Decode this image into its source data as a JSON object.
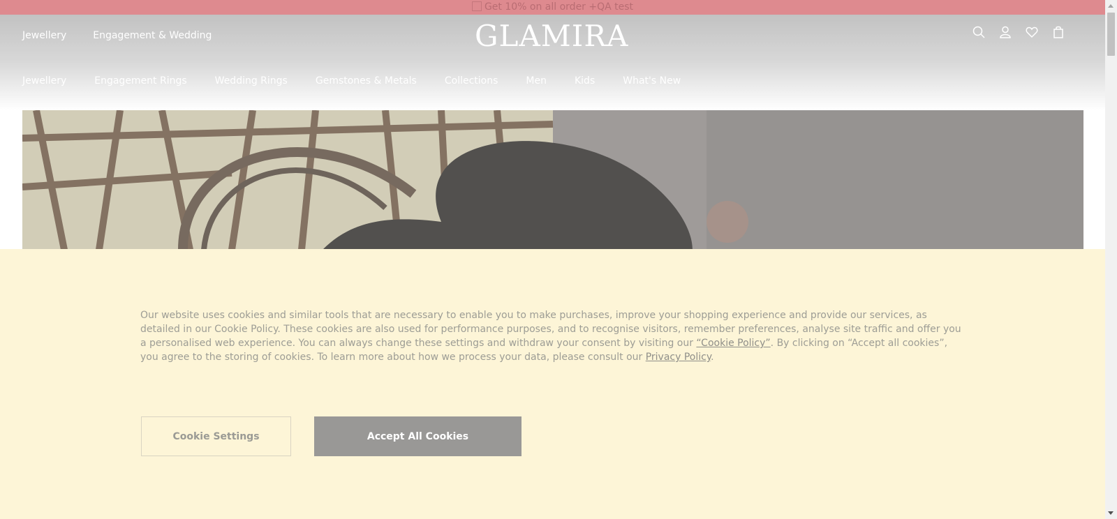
{
  "promo": {
    "text": "Get 10% on all order +QA test"
  },
  "header": {
    "top_nav": [
      "Jewellery",
      "Engagement & Wedding"
    ],
    "logo": "GLAMIRA",
    "main_nav": [
      "Jewellery",
      "Engagement Rings",
      "Wedding Rings",
      "Gemstones & Metals",
      "Collections",
      "Men",
      "Kids",
      "What's New"
    ],
    "icons": [
      "search-icon",
      "account-icon",
      "wishlist-icon",
      "cart-icon"
    ]
  },
  "cookie": {
    "text_1": "Our website uses cookies and similar tools that are necessary to enable you to make purchases, improve your shopping experience and provide our services, as detailed in our Cookie Policy. These cookies are also used for performance purposes, and to recognise visitors, remember preferences, analyse site traffic and offer you a personalised web experience. You can always change these settings and withdraw your consent by visiting our ",
    "policy_link": "“Cookie Policy”",
    "text_2": ". By clicking on “Accept all cookies”, you agree to the storing of cookies. To learn more about how we process your data, please consult our ",
    "privacy_link": "Privacy Policy",
    "text_3": ".",
    "settings_label": "Cookie Settings",
    "accept_label": "Accept All Cookies"
  },
  "colors": {
    "promo": "#de8a8f",
    "banner": "#fdf5d7",
    "accept": "#999896"
  }
}
